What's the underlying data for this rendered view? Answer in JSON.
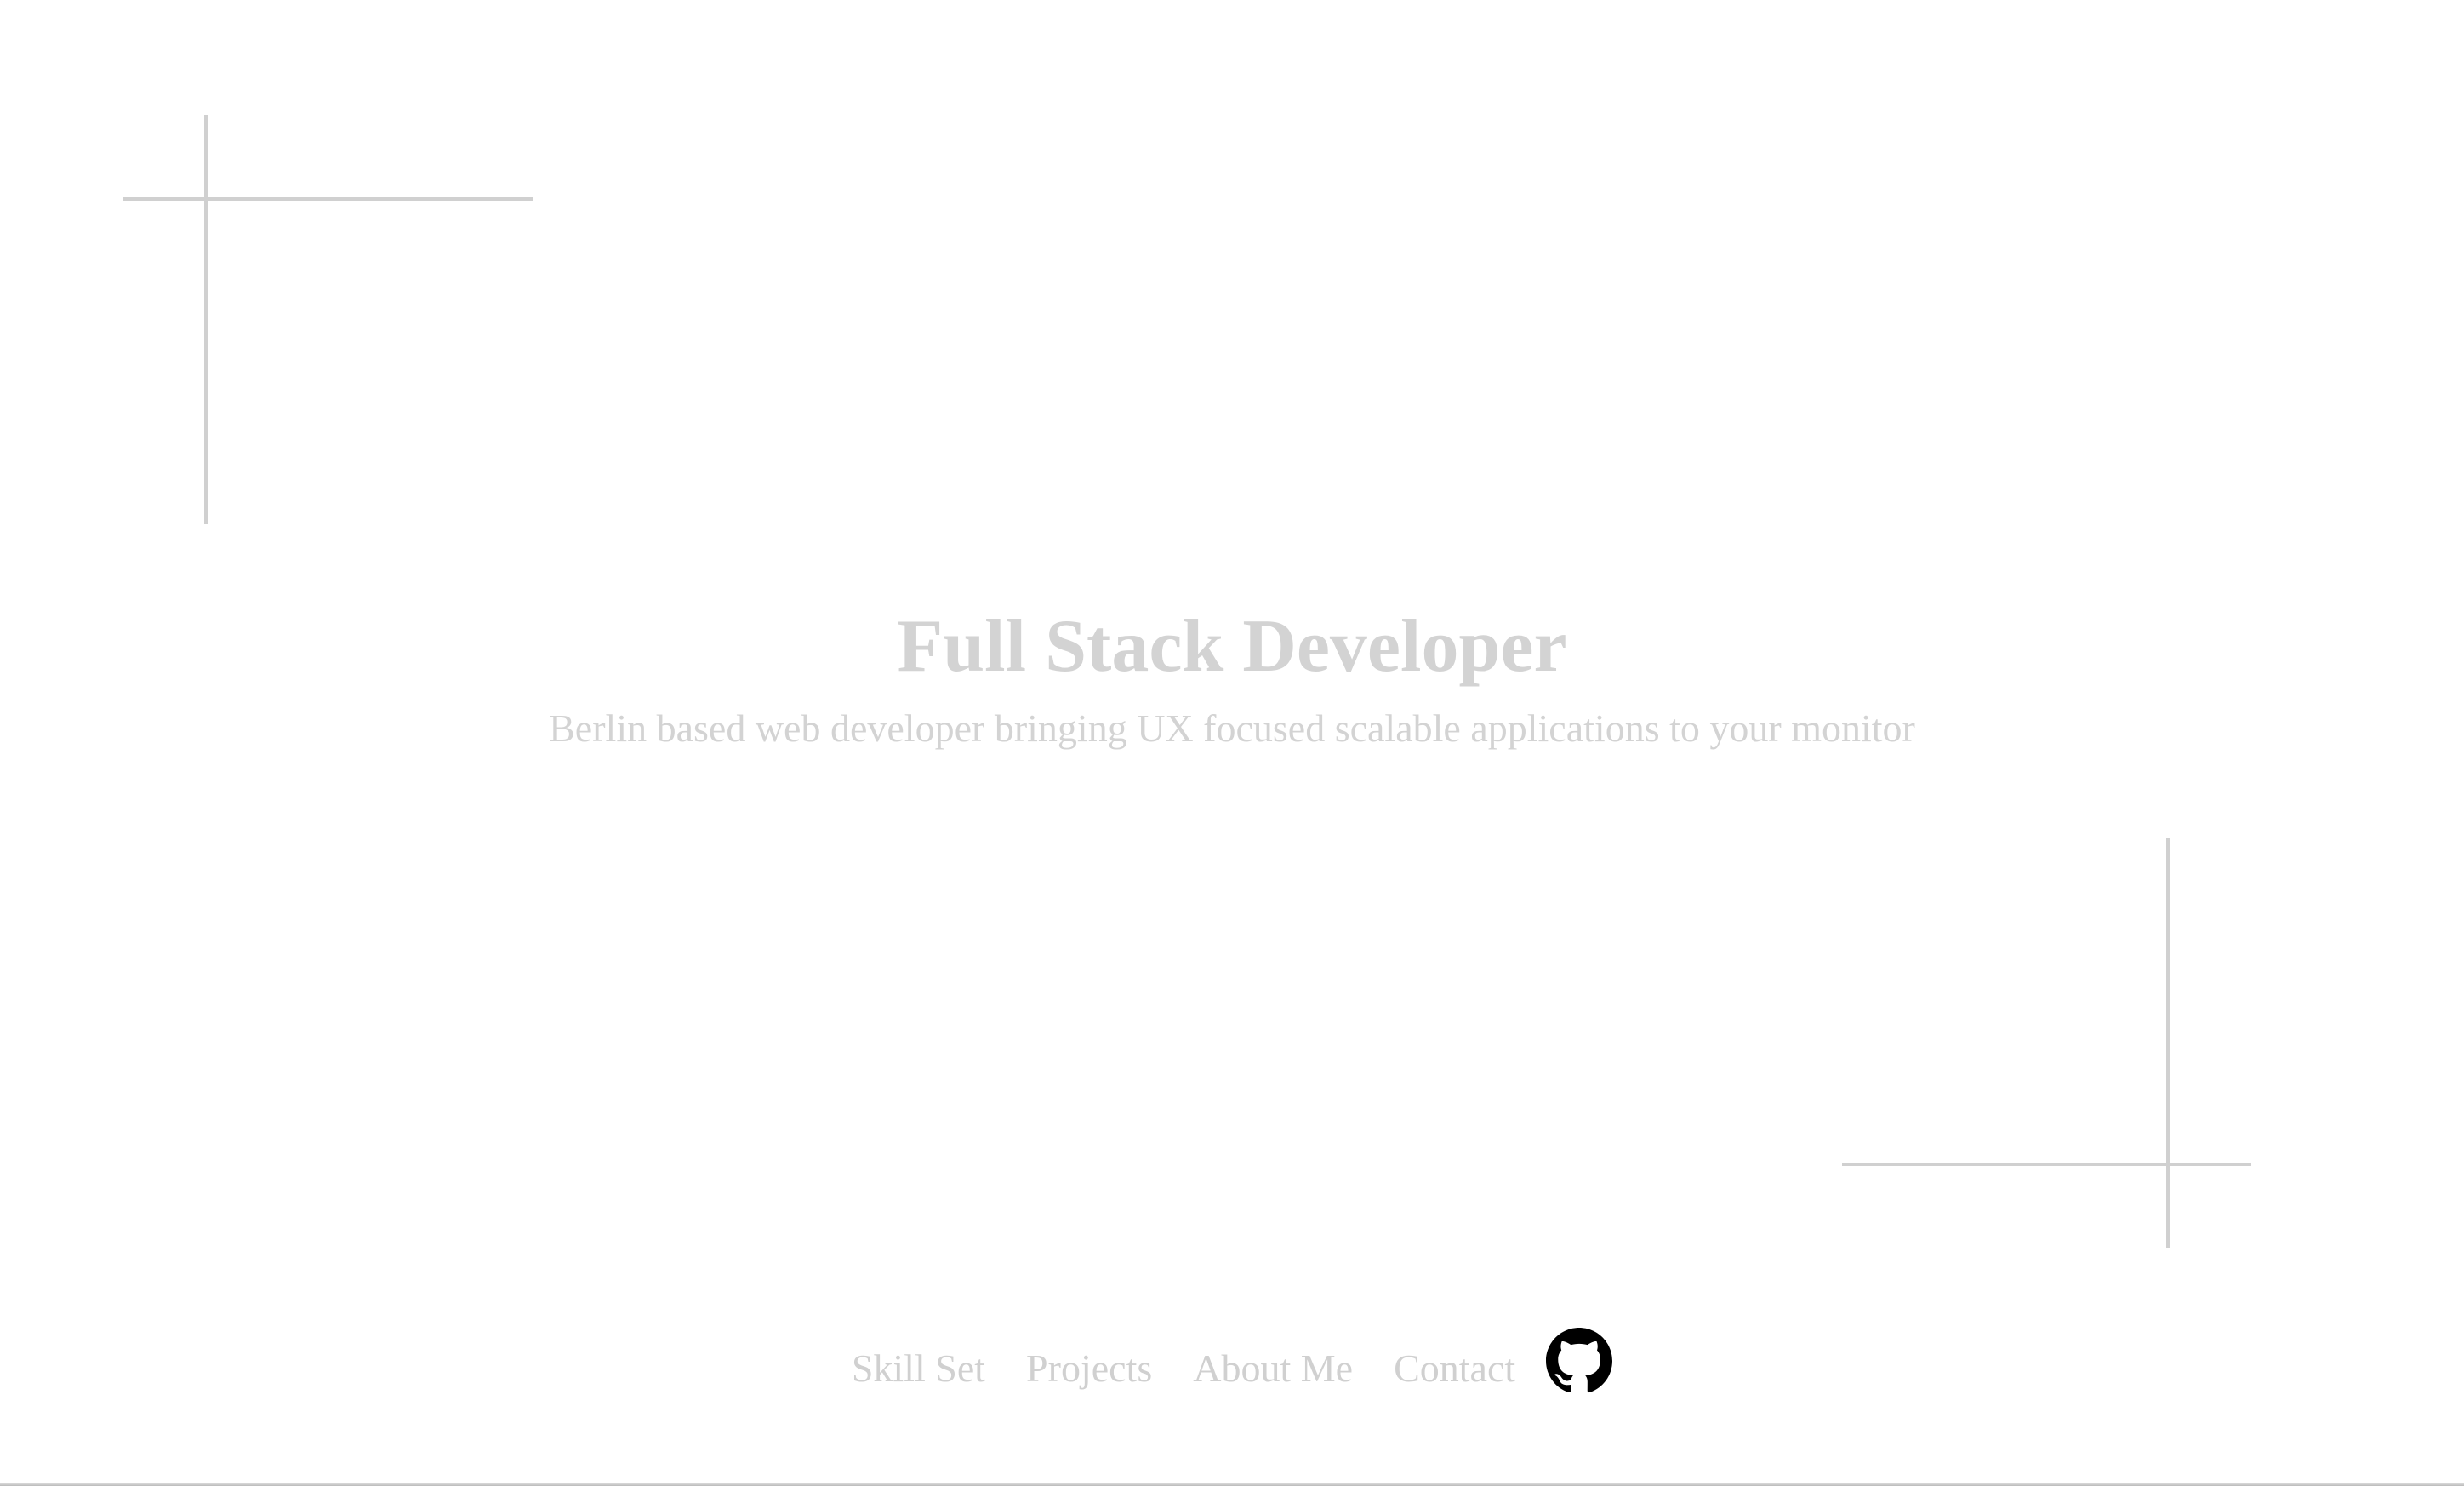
{
  "hero": {
    "title": "Full Stack Developer",
    "subtitle": "Berlin based web developer bringing UX focused scalable applications to your monitor"
  },
  "nav": {
    "items": [
      {
        "label": "Skill Set"
      },
      {
        "label": "Projects"
      },
      {
        "label": "About Me"
      },
      {
        "label": "Contact"
      }
    ],
    "github_icon": "github-icon"
  },
  "colors": {
    "background": "#ffffff",
    "text_muted": "#d3d3d3",
    "decoration_line": "#d0d0d0",
    "icon": "#000000"
  }
}
